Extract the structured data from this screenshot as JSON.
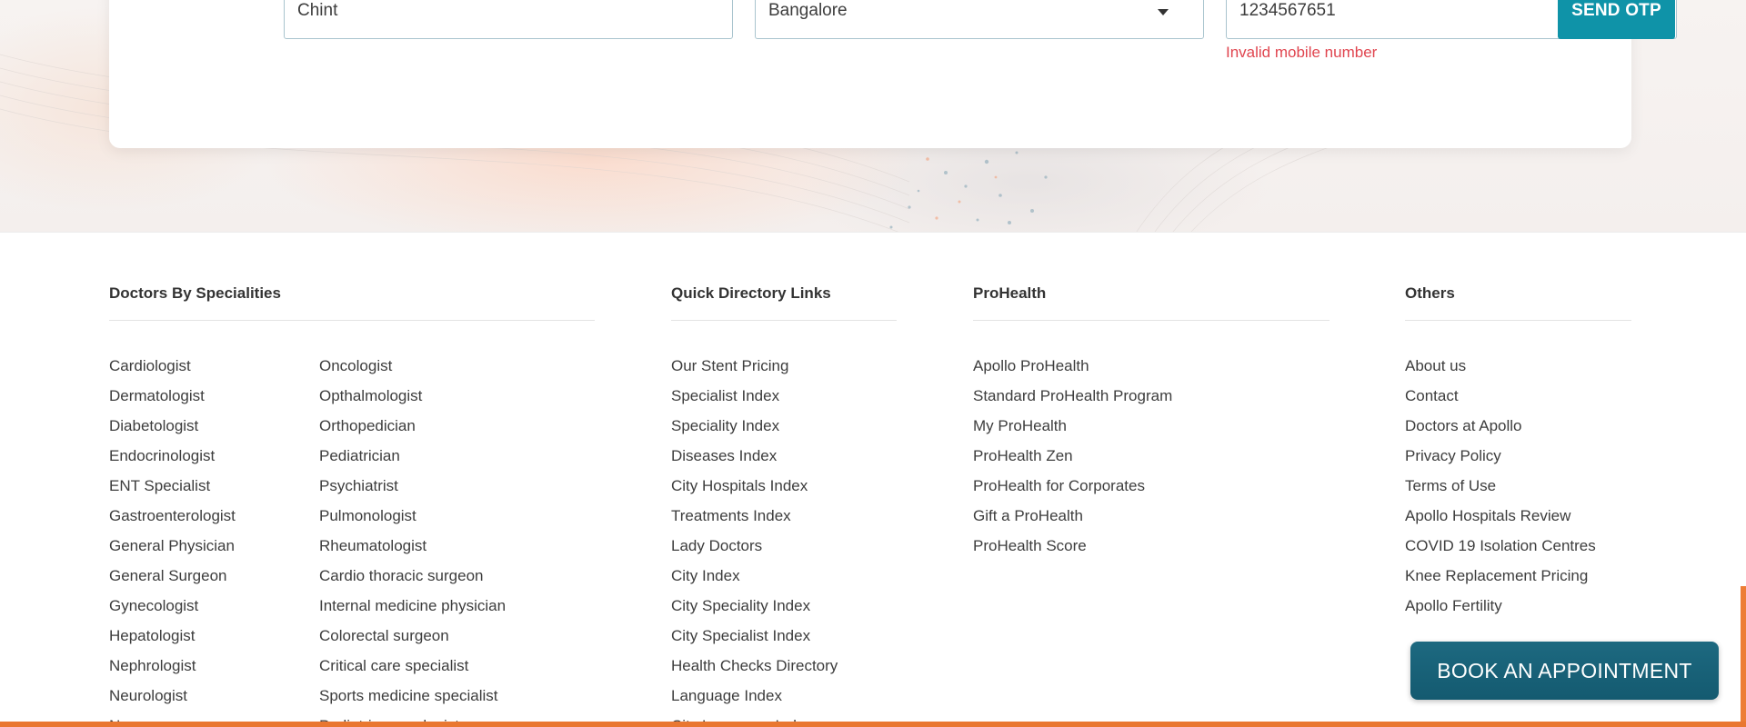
{
  "form": {
    "name_value": "Chint",
    "city_value": "Bangalore",
    "mobile_value": "1234567651",
    "send_otp_label": "SEND OTP",
    "error_message": "Invalid mobile number"
  },
  "footer": {
    "specialities": {
      "heading": "Doctors By Specialities",
      "col1": [
        "Cardiologist",
        "Dermatologist",
        "Diabetologist",
        "Endocrinologist",
        "ENT Specialist",
        "Gastroenterologist",
        "General Physician",
        "General Surgeon",
        "Gynecologist",
        "Hepatologist",
        "Nephrologist",
        "Neurologist",
        "N"
      ],
      "col2": [
        "Oncologist",
        "Opthalmologist",
        "Orthopedician",
        "Pediatrician",
        "Psychiatrist",
        "Pulmonologist",
        "Rheumatologist",
        "Cardio thoracic surgeon",
        "Internal medicine physician",
        "Colorectal surgeon",
        "Critical care specialist",
        "Sports medicine specialist",
        "Pediatric neurologist"
      ]
    },
    "quick_links": {
      "heading": "Quick Directory Links",
      "items": [
        "Our Stent Pricing",
        "Specialist Index",
        "Speciality Index",
        "Diseases Index",
        "City Hospitals Index",
        "Treatments Index",
        "Lady Doctors",
        "City Index",
        "City Speciality Index",
        "City Specialist Index",
        "Health Checks Directory",
        "Language Index",
        "City Language Index"
      ]
    },
    "prohealth": {
      "heading": "ProHealth",
      "items": [
        "Apollo ProHealth",
        "Standard ProHealth Program",
        "My ProHealth",
        "ProHealth Zen",
        "ProHealth for Corporates",
        "Gift a ProHealth",
        "ProHealth Score"
      ]
    },
    "others": {
      "heading": "Others",
      "items": [
        "About us",
        "Contact",
        "Doctors at Apollo",
        "Privacy Policy",
        "Terms of Use",
        "Apollo Hospitals Review",
        "COVID 19 Isolation Centres",
        "Knee Replacement Pricing",
        "Apollo Fertility"
      ]
    }
  },
  "cta": {
    "label": "BOOK AN APPOINTMENT"
  },
  "colors": {
    "accent": "#0f93a8",
    "cta": "#145a70",
    "error": "#e0454f",
    "brand_orange": "#e97731"
  }
}
